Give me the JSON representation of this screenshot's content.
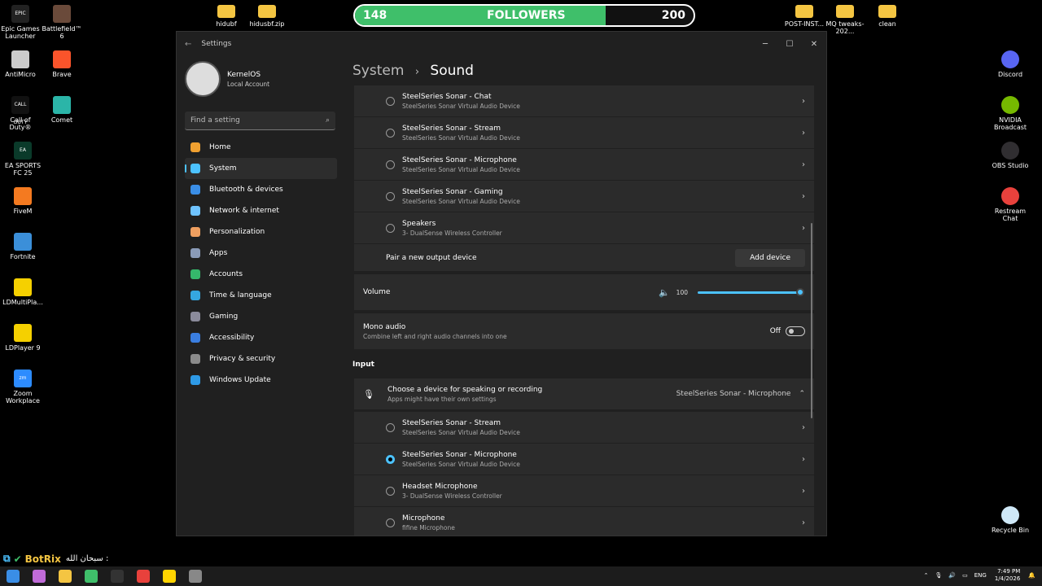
{
  "desktop": {
    "left_icons": [
      {
        "label": "Epic Games Launcher",
        "color": "#222222",
        "glyph": "EPIC"
      },
      {
        "label": "Battlefield™ 6",
        "color": "#6a4a3a",
        "glyph": ""
      },
      {
        "label": "AntiMicro",
        "color": "#cccccc",
        "glyph": ""
      },
      {
        "label": "Brave",
        "color": "#fb542b",
        "glyph": ""
      },
      {
        "label": "Call of Duty®",
        "color": "#111111",
        "glyph": "CALL DUTY"
      },
      {
        "label": "Comet",
        "color": "#2bb5a8",
        "glyph": ""
      },
      {
        "label": "EA SPORTS FC 25",
        "color": "#0a3a2a",
        "glyph": "EA"
      },
      {
        "label": "FiveM",
        "color": "#f47a20",
        "glyph": ""
      },
      {
        "label": "Fortnite",
        "color": "#3b8fd9",
        "glyph": ""
      },
      {
        "label": "LDMultiPla...",
        "color": "#f5d000",
        "glyph": ""
      },
      {
        "label": "LDPlayer 9",
        "color": "#f5d000",
        "glyph": ""
      },
      {
        "label": "Zoom Workplace",
        "color": "#2d8cff",
        "glyph": "zm"
      }
    ],
    "top_icons": [
      {
        "label": "hidubf"
      },
      {
        "label": "hidusbf.zip"
      },
      {
        "label": "POST-INST..."
      },
      {
        "label": "MQ tweaks-202..."
      },
      {
        "label": "clean"
      }
    ],
    "right_icons": [
      {
        "label": "Discord",
        "color": "#5865f2"
      },
      {
        "label": "NVIDIA Broadcast",
        "color": "#76b900"
      },
      {
        "label": "OBS Studio",
        "color": "#302e31"
      },
      {
        "label": "Restream Chat",
        "color": "#e8413c"
      },
      {
        "label": "Recycle Bin",
        "color": "#cfe8f7"
      }
    ],
    "botrix": "BotRix",
    "botrix_text": "سبحان الله :"
  },
  "followers": {
    "current": "148",
    "label": "FOLLOWERS",
    "goal": "200",
    "progress": 0.74
  },
  "window": {
    "title": "Settings",
    "controls": {
      "minimize": "─",
      "maximize": "☐",
      "close": "✕"
    },
    "user": {
      "name": "KernelOS",
      "account": "Local Account"
    },
    "search_placeholder": "Find a setting",
    "nav": [
      {
        "label": "Home",
        "color": "#f0a030"
      },
      {
        "label": "System",
        "color": "#4cc2ff"
      },
      {
        "label": "Bluetooth & devices",
        "color": "#3a8ee6"
      },
      {
        "label": "Network & internet",
        "color": "#6fc3ff"
      },
      {
        "label": "Personalization",
        "color": "#f0a060"
      },
      {
        "label": "Apps",
        "color": "#8a9bb8"
      },
      {
        "label": "Accounts",
        "color": "#35b86b"
      },
      {
        "label": "Time & language",
        "color": "#35a7e0"
      },
      {
        "label": "Gaming",
        "color": "#8b8b9b"
      },
      {
        "label": "Accessibility",
        "color": "#3a7ee0"
      },
      {
        "label": "Privacy & security",
        "color": "#8b8b8b"
      },
      {
        "label": "Windows Update",
        "color": "#2e9ae6"
      }
    ],
    "breadcrumb": {
      "parent": "System",
      "sep": "›",
      "current": "Sound"
    },
    "output_devices": [
      {
        "name": "SteelSeries Sonar - Chat",
        "sub": "SteelSeries Sonar Virtual Audio Device"
      },
      {
        "name": "SteelSeries Sonar - Stream",
        "sub": "SteelSeries Sonar Virtual Audio Device"
      },
      {
        "name": "SteelSeries Sonar - Microphone",
        "sub": "SteelSeries Sonar Virtual Audio Device"
      },
      {
        "name": "SteelSeries Sonar - Gaming",
        "sub": "SteelSeries Sonar Virtual Audio Device"
      },
      {
        "name": "Speakers",
        "sub": "3- DualSense Wireless Controller"
      }
    ],
    "pair": {
      "label": "Pair a new output device",
      "button": "Add device"
    },
    "volume": {
      "label": "Volume",
      "value": "100",
      "level": 1.0
    },
    "mono": {
      "label": "Mono audio",
      "sub": "Combine left and right audio channels into one",
      "state": "Off"
    },
    "input_heading": "Input",
    "input_chooser": {
      "label": "Choose a device for speaking or recording",
      "sub": "Apps might have their own settings",
      "selected": "SteelSeries Sonar - Microphone"
    },
    "input_devices": [
      {
        "name": "SteelSeries Sonar - Stream",
        "sub": "SteelSeries Sonar Virtual Audio Device",
        "selected": false
      },
      {
        "name": "SteelSeries Sonar - Microphone",
        "sub": "SteelSeries Sonar Virtual Audio Device",
        "selected": true
      },
      {
        "name": "Headset Microphone",
        "sub": "3- DualSense Wireless Controller",
        "selected": false
      },
      {
        "name": "Microphone",
        "sub": "fifine Microphone",
        "selected": false
      }
    ]
  },
  "taskbar": {
    "icons": [
      "start-icon",
      "copilot-icon",
      "file-explorer-icon",
      "xbox-icon",
      "call-of-duty-icon",
      "record-icon",
      "chrome-icon",
      "settings-icon"
    ],
    "tray": {
      "lang": "ENG",
      "time": "7:49 PM",
      "date": "1/4/2026"
    }
  }
}
